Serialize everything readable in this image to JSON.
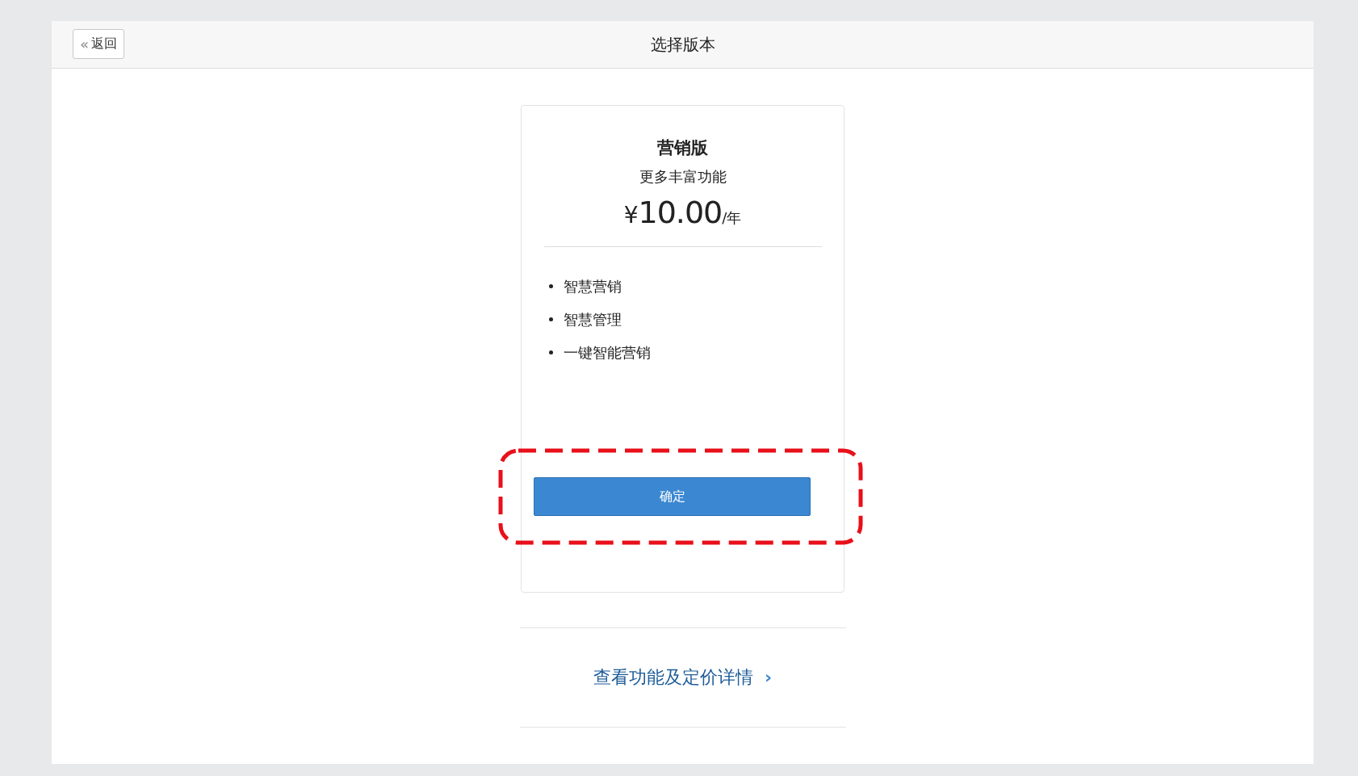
{
  "header": {
    "back_button": {
      "icon": "«",
      "label": "返回"
    },
    "title": "选择版本"
  },
  "plan": {
    "name": "营销版",
    "subtitle": "更多丰富功能",
    "currency": "¥",
    "price": "10.00",
    "period": "/年",
    "features": [
      "智慧营销",
      "智慧管理",
      "一键智能营销"
    ],
    "confirm_button": "确定"
  },
  "details_link": {
    "label": "查看功能及定价详情",
    "chevron": "›"
  }
}
